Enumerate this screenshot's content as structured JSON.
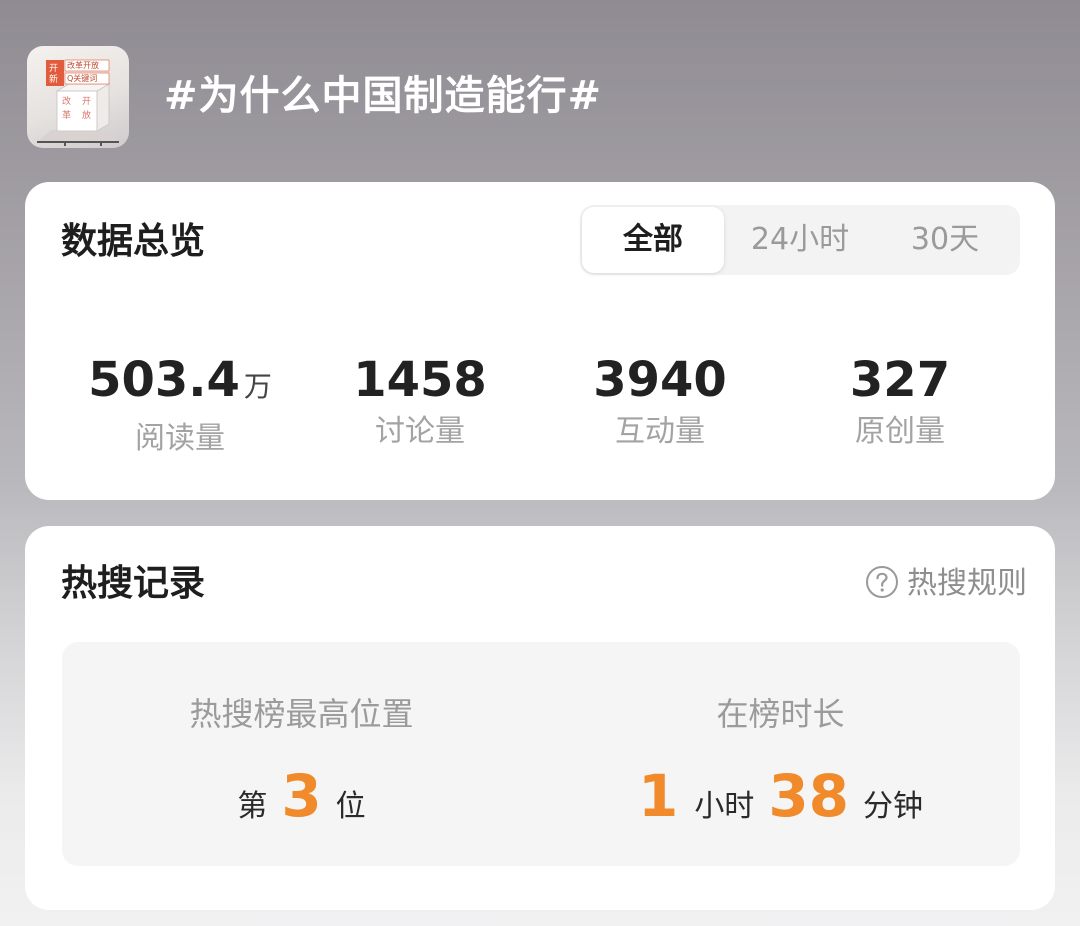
{
  "header": {
    "cover_icon": "topic-cover-image",
    "cover_text": [
      "开",
      "新",
      "改革开放",
      "Q关键词",
      "改",
      "革",
      "开",
      "放"
    ],
    "title": "#为什么中国制造能行#"
  },
  "overview": {
    "heading": "数据总览",
    "tabs": [
      {
        "label": "全部",
        "active": true
      },
      {
        "label": "24小时",
        "active": false
      },
      {
        "label": "30天",
        "active": false
      }
    ],
    "stats": [
      {
        "value": "503.4",
        "unit": "万",
        "label": "阅读量"
      },
      {
        "value": "1458",
        "unit": "",
        "label": "讨论量"
      },
      {
        "value": "3940",
        "unit": "",
        "label": "互动量"
      },
      {
        "value": "327",
        "unit": "",
        "label": "原创量"
      }
    ]
  },
  "hot_search": {
    "heading": "热搜记录",
    "rules_icon": "question-circle-icon",
    "rules_label": "热搜规则",
    "highest_position": {
      "label": "热搜榜最高位置",
      "prefix": "第",
      "value": "3",
      "suffix": "位"
    },
    "duration": {
      "label": "在榜时长",
      "hours": "1",
      "hours_unit": "小时",
      "minutes": "38",
      "minutes_unit": "分钟"
    }
  },
  "colors": {
    "accent_orange": "#f08a2b",
    "card_bg": "#ffffff",
    "panel_bg": "#f5f5f5"
  }
}
